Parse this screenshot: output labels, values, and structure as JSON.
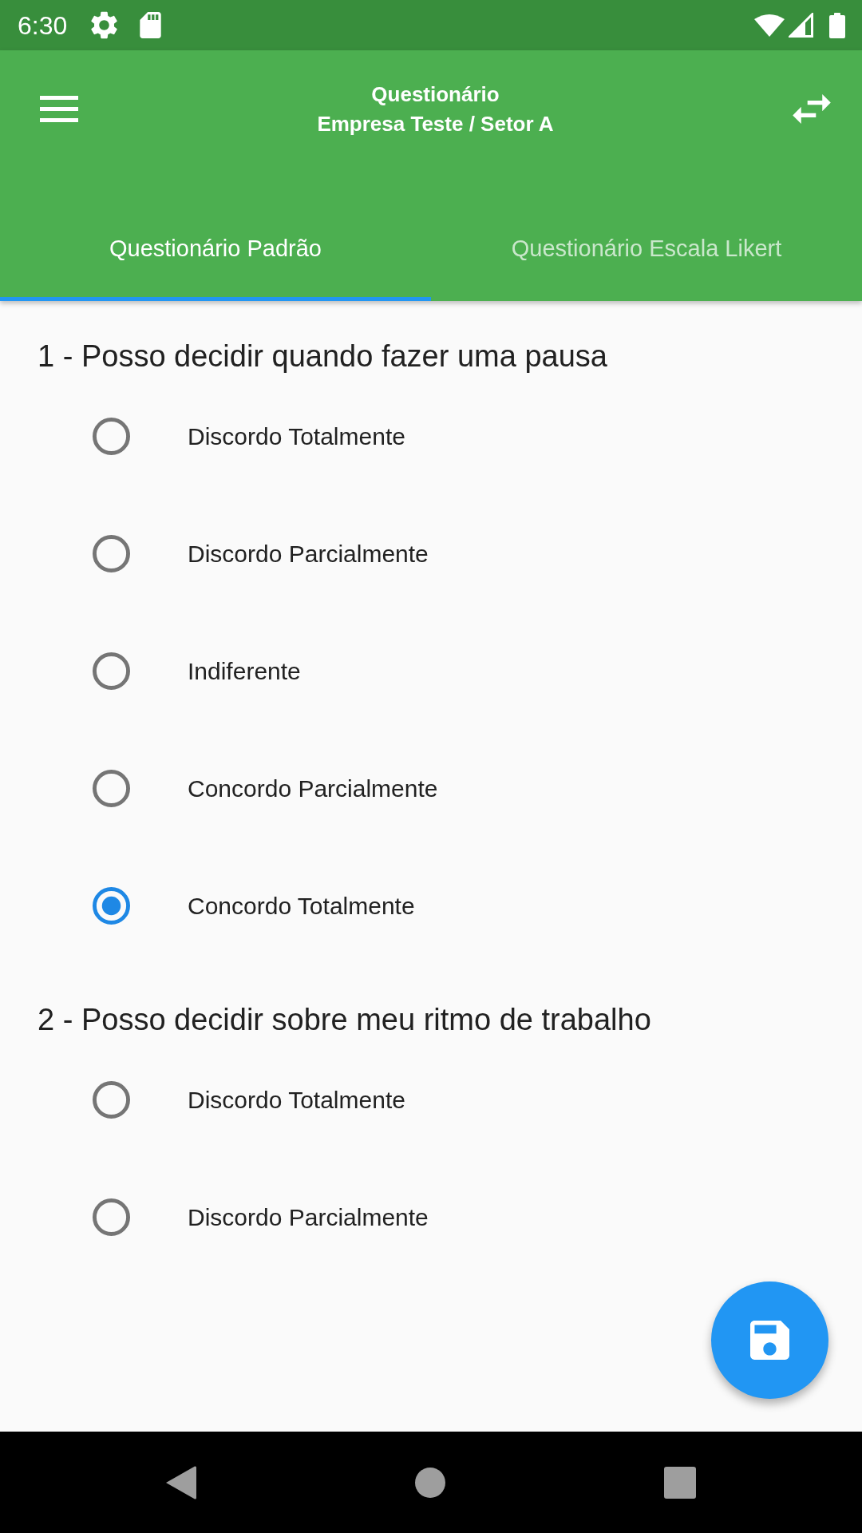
{
  "status_bar": {
    "time": "6:30"
  },
  "app_bar": {
    "title": "Questionário",
    "subtitle": "Empresa Teste / Setor A"
  },
  "tabs": [
    {
      "label": "Questionário Padrão",
      "selected": true
    },
    {
      "label": "Questionário Escala Likert",
      "selected": false
    }
  ],
  "questions": [
    {
      "text": "1 - Posso decidir quando fazer uma pausa",
      "options": [
        {
          "label": "Discordo Totalmente",
          "selected": false
        },
        {
          "label": "Discordo Parcialmente",
          "selected": false
        },
        {
          "label": "Indiferente",
          "selected": false
        },
        {
          "label": "Concordo Parcialmente",
          "selected": false
        },
        {
          "label": "Concordo Totalmente",
          "selected": true
        }
      ]
    },
    {
      "text": "2 - Posso decidir sobre meu ritmo de trabalho",
      "options": [
        {
          "label": "Discordo Totalmente",
          "selected": false
        },
        {
          "label": "Discordo Parcialmente",
          "selected": false
        }
      ]
    }
  ]
}
